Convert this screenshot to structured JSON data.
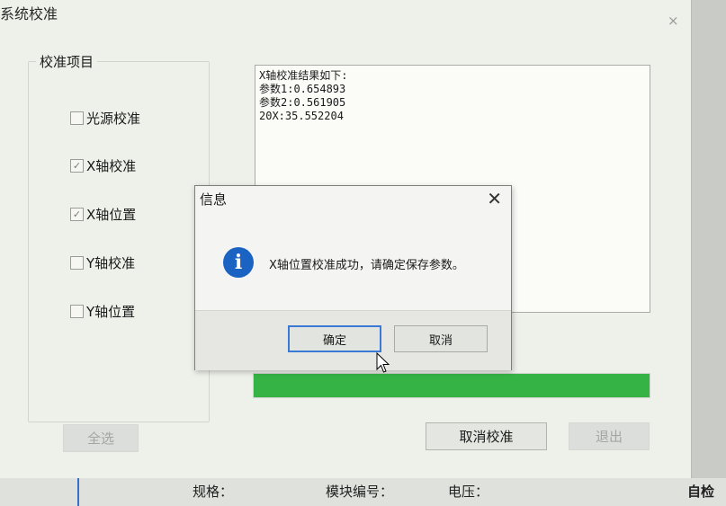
{
  "window": {
    "title": "系统校准",
    "close_glyph": "×"
  },
  "calibration_items": {
    "group_title": "校准项目",
    "items": [
      {
        "label": "光源校准",
        "checked": false
      },
      {
        "label": "X轴校准",
        "checked": true
      },
      {
        "label": "X轴位置",
        "checked": true
      },
      {
        "label": "Y轴校准",
        "checked": false
      },
      {
        "label": "Y轴位置",
        "checked": false
      }
    ]
  },
  "result": {
    "lines": [
      "X轴校准结果如下:",
      "参数1:0.654893",
      "参数2:0.561905",
      "20X:35.552204"
    ]
  },
  "progress": {
    "value": 1.0,
    "color": "#35b445"
  },
  "buttons": {
    "select_all": "全选",
    "cancel_calibration": "取消校准",
    "exit": "退出"
  },
  "background_partial": {
    "spec": "规格：",
    "module_no": "模块编号：",
    "current": "电压：",
    "right": "自检"
  },
  "dialog": {
    "title": "信息",
    "close_glyph": "✕",
    "icon": "info-icon",
    "message": "X轴位置校准成功，请确定保存参数。",
    "ok_label": "确定",
    "cancel_label": "取消"
  },
  "colors": {
    "info_icon": "#1a63c2",
    "progress": "#35b445"
  }
}
